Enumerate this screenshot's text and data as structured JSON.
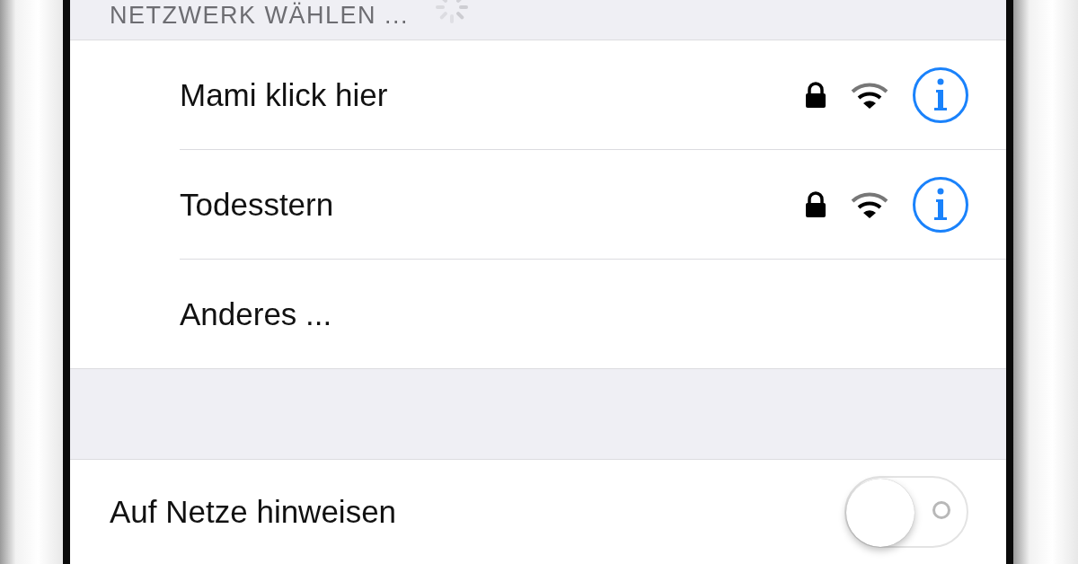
{
  "section_header": {
    "title": "NETZWERK WÄHLEN ...",
    "loading": true
  },
  "networks": [
    {
      "kind": "network",
      "name": "Mami klick hier",
      "locked": true
    },
    {
      "kind": "network",
      "name": "Todesstern",
      "locked": true
    },
    {
      "kind": "other",
      "name": "Anderes ..."
    }
  ],
  "ask_to_join": {
    "label": "Auf Netze hinweisen",
    "on": false
  }
}
